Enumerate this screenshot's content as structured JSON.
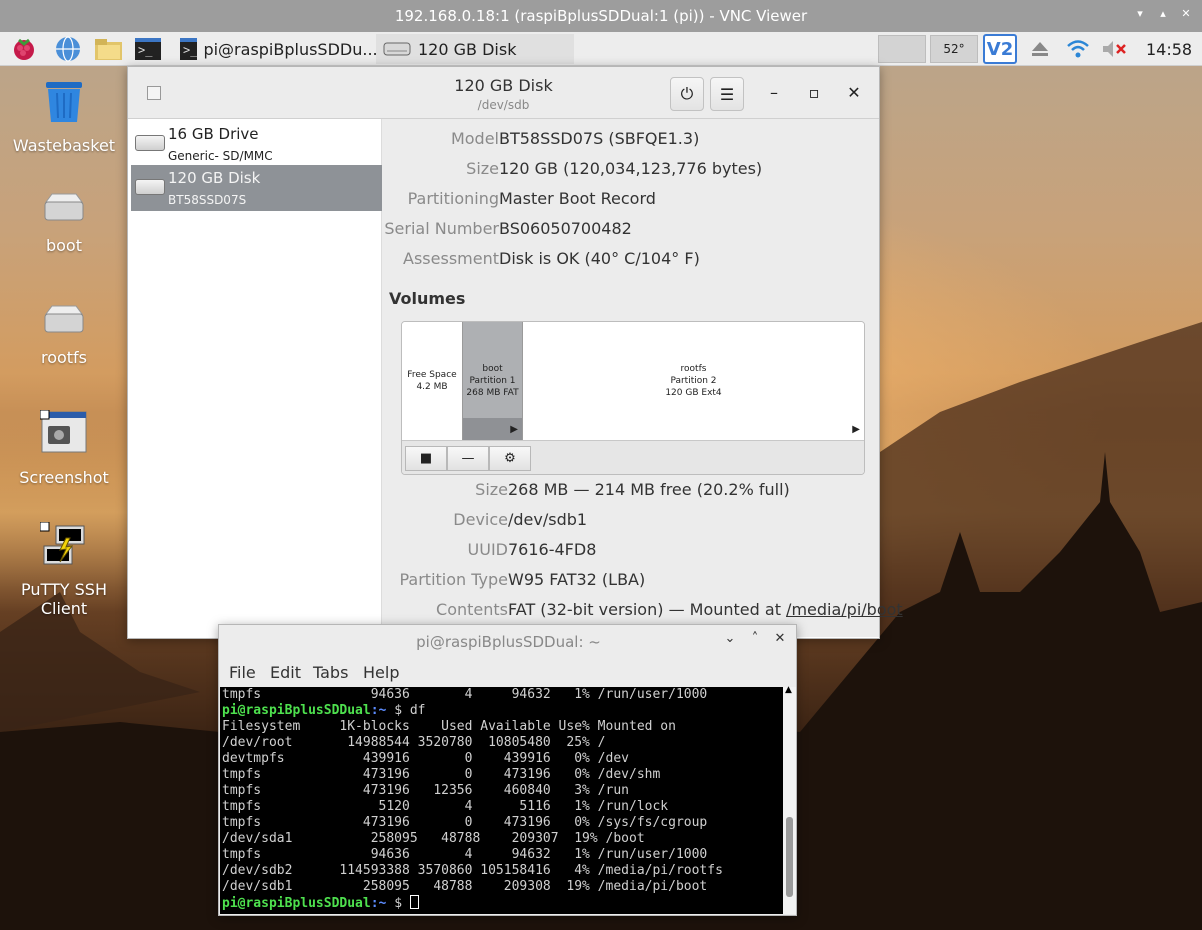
{
  "vnc": {
    "title": "192.168.0.18:1 (raspiBplusSDDual:1 (pi)) - VNC Viewer"
  },
  "panel": {
    "tasks": [
      {
        "label": "pi@raspiBplusSDDu..."
      },
      {
        "label": "120 GB Disk"
      }
    ],
    "temperature": "52°",
    "clock": "14:58"
  },
  "desktop_icons": [
    {
      "label": "Wastebasket"
    },
    {
      "label": "boot"
    },
    {
      "label": "rootfs"
    },
    {
      "label": "Screenshot"
    },
    {
      "label": "PuTTY SSH Client"
    }
  ],
  "disks": {
    "title": "120 GB Disk",
    "subtitle": "/dev/sdb",
    "drives": [
      {
        "name": "16 GB Drive",
        "sub": "Generic- SD/MMC"
      },
      {
        "name": "120 GB Disk",
        "sub": "BT58SSD07S"
      }
    ],
    "props": [
      {
        "k": "Model",
        "v": "BT58SSD07S (SBFQE1.3)"
      },
      {
        "k": "Size",
        "v": "120 GB (120,034,123,776 bytes)"
      },
      {
        "k": "Partitioning",
        "v": "Master Boot Record"
      },
      {
        "k": "Serial Number",
        "v": "BS06050700482"
      },
      {
        "k": "Assessment",
        "v": "Disk is OK (40° C/104° F)"
      }
    ],
    "volumes_label": "Volumes",
    "segments": [
      {
        "l1": "Free Space",
        "l2": "4.2 MB",
        "l3": ""
      },
      {
        "l1": "boot",
        "l2": "Partition 1",
        "l3": "268 MB FAT"
      },
      {
        "l1": "rootfs",
        "l2": "Partition 2",
        "l3": "120 GB Ext4"
      }
    ],
    "part_props": [
      {
        "k": "Size",
        "v": "268 MB — 214 MB free (20.2% full)"
      },
      {
        "k": "Device",
        "v": "/dev/sdb1"
      },
      {
        "k": "UUID",
        "v": "7616-4FD8"
      },
      {
        "k": "Partition Type",
        "v": "W95 FAT32 (LBA)"
      },
      {
        "k": "Contents",
        "v": "FAT (32-bit version) — Mounted at ",
        "link": "/media/pi/boot"
      }
    ]
  },
  "terminal": {
    "title": "pi@raspiBplusSDDual: ~",
    "menu": [
      "File",
      "Edit",
      "Tabs",
      "Help"
    ],
    "prompt_user": "pi@raspiBplusSDDual",
    "prompt_path": ":~",
    "lines": [
      {
        "text": "tmpfs              94636       4     94632   1% /run/user/1000"
      },
      {
        "prompt": true,
        "cmd": " $ df"
      },
      {
        "text": "Filesystem     1K-blocks    Used Available Use% Mounted on"
      },
      {
        "text": "/dev/root       14988544 3520780  10805480  25% /"
      },
      {
        "text": "devtmpfs          439916       0    439916   0% /dev"
      },
      {
        "text": "tmpfs             473196       0    473196   0% /dev/shm"
      },
      {
        "text": "tmpfs             473196   12356    460840   3% /run"
      },
      {
        "text": "tmpfs               5120       4      5116   1% /run/lock"
      },
      {
        "text": "tmpfs             473196       0    473196   0% /sys/fs/cgroup"
      },
      {
        "text": "/dev/sda1          258095   48788    209307  19% /boot"
      },
      {
        "text": "tmpfs              94636       4     94632   1% /run/user/1000"
      },
      {
        "text": "/dev/sdb2      114593388 3570860 105158416   4% /media/pi/rootfs"
      },
      {
        "text": "/dev/sdb1         258095   48788    209308  19% /media/pi/boot"
      },
      {
        "prompt": true,
        "cmd": " $ ",
        "cursor": true
      }
    ]
  }
}
